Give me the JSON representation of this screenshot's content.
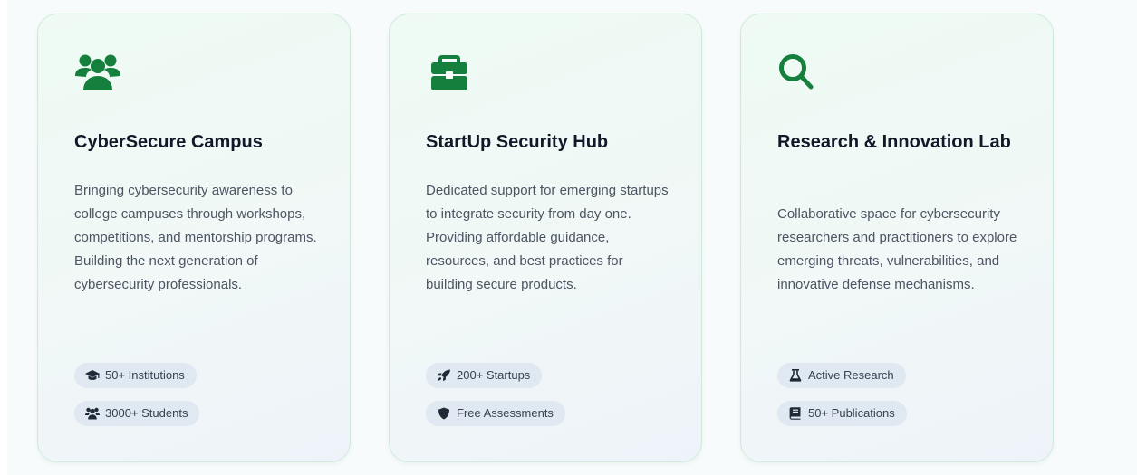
{
  "colors": {
    "accent_green": "#15803d",
    "badge_icon": "#1f2937",
    "title": "#111827",
    "body_text": "#4b5563",
    "badge_bg": "#e0e9f1",
    "card_border": "#cfeadb"
  },
  "cards": [
    {
      "icon": "users-group-icon",
      "title": "CyberSecure Campus",
      "description": "Bringing cybersecurity awareness to college campuses through workshops, competitions, and mentorship programs. Building the next generation of cybersecurity professionals.",
      "badges": [
        {
          "icon": "graduation-cap-icon",
          "label": "50+ Institutions"
        },
        {
          "icon": "users-icon",
          "label": "3000+ Students"
        }
      ]
    },
    {
      "icon": "briefcase-icon",
      "title": "StartUp Security Hub",
      "description": "Dedicated support for emerging startups to integrate security from day one. Providing affordable guidance, resources, and best practices for building secure products.",
      "badges": [
        {
          "icon": "rocket-icon",
          "label": "200+ Startups"
        },
        {
          "icon": "shield-icon",
          "label": "Free Assessments"
        }
      ]
    },
    {
      "icon": "magnifier-icon",
      "title": "Research & Innovation Lab",
      "description": "Collaborative space for cybersecurity researchers and practitioners to explore emerging threats, vulnerabilities, and innovative defense mechanisms.",
      "badges": [
        {
          "icon": "flask-icon",
          "label": "Active Research"
        },
        {
          "icon": "book-icon",
          "label": "50+ Publications"
        }
      ]
    }
  ]
}
